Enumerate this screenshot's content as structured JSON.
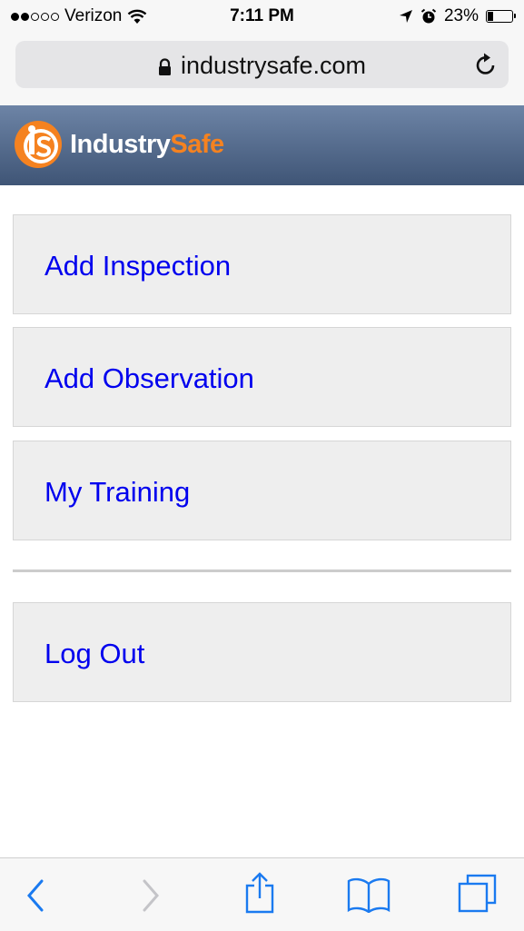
{
  "status_bar": {
    "carrier": "Verizon",
    "time": "7:11 PM",
    "battery": "23%",
    "battery_level": 0.23,
    "signal_bars_filled": 2,
    "signal_bars_total": 5
  },
  "browser": {
    "url": "industrysafe.com"
  },
  "header": {
    "logo_text_white": "Industry",
    "logo_text_orange": "Safe",
    "brand_color": "#f58220"
  },
  "menu": {
    "add_inspection": "Add Inspection",
    "add_observation": "Add Observation",
    "my_training": "My Training",
    "log_out": "Log Out",
    "link_color": "#0000ee"
  },
  "toolbar": {
    "icons": [
      "back-icon",
      "forward-icon",
      "share-icon",
      "bookmarks-icon",
      "tabs-icon"
    ]
  }
}
